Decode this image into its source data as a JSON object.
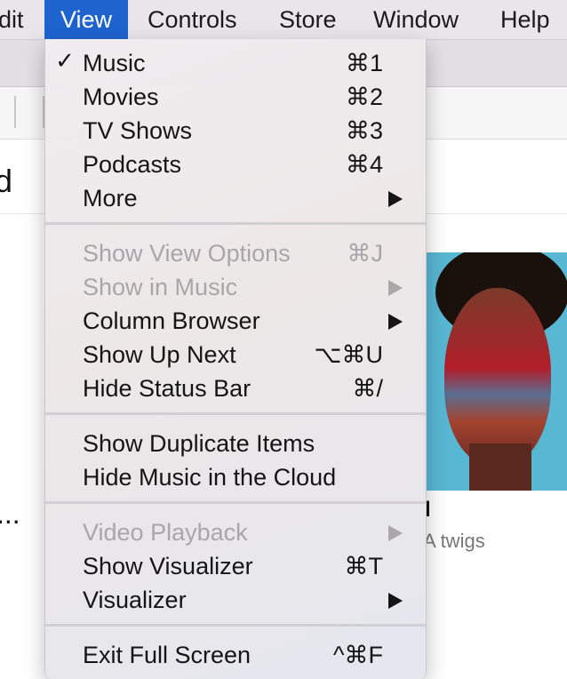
{
  "menubar": {
    "items": [
      "dit",
      "View",
      "Controls",
      "Store",
      "Window",
      "Help"
    ],
    "active_index": 1,
    "accent_color": "#1f63cf"
  },
  "background": {
    "title_fragment": "d",
    "ellipsis": "...",
    "album_caption_1": "l",
    "album_caption_2": "A twigs"
  },
  "view_menu": {
    "sections": [
      [
        {
          "label": "Music",
          "shortcut": "⌘1",
          "checked": true,
          "enabled": true,
          "submenu": false
        },
        {
          "label": "Movies",
          "shortcut": "⌘2",
          "checked": false,
          "enabled": true,
          "submenu": false
        },
        {
          "label": "TV Shows",
          "shortcut": "⌘3",
          "checked": false,
          "enabled": true,
          "submenu": false
        },
        {
          "label": "Podcasts",
          "shortcut": "⌘4",
          "checked": false,
          "enabled": true,
          "submenu": false
        },
        {
          "label": "More",
          "shortcut": "",
          "checked": false,
          "enabled": true,
          "submenu": true
        }
      ],
      [
        {
          "label": "Show View Options",
          "shortcut": "⌘J",
          "checked": false,
          "enabled": false,
          "submenu": false
        },
        {
          "label": "Show in Music",
          "shortcut": "",
          "checked": false,
          "enabled": false,
          "submenu": true
        },
        {
          "label": "Column Browser",
          "shortcut": "",
          "checked": false,
          "enabled": true,
          "submenu": true
        },
        {
          "label": "Show Up Next",
          "shortcut": "⌥⌘U",
          "checked": false,
          "enabled": true,
          "submenu": false
        },
        {
          "label": "Hide Status Bar",
          "shortcut": "⌘/",
          "checked": false,
          "enabled": true,
          "submenu": false
        }
      ],
      [
        {
          "label": "Show Duplicate Items",
          "shortcut": "",
          "checked": false,
          "enabled": true,
          "submenu": false
        },
        {
          "label": "Hide Music in the Cloud",
          "shortcut": "",
          "checked": false,
          "enabled": true,
          "submenu": false
        }
      ],
      [
        {
          "label": "Video Playback",
          "shortcut": "",
          "checked": false,
          "enabled": false,
          "submenu": true
        },
        {
          "label": "Show Visualizer",
          "shortcut": "⌘T",
          "checked": false,
          "enabled": true,
          "submenu": false
        },
        {
          "label": "Visualizer",
          "shortcut": "",
          "checked": false,
          "enabled": true,
          "submenu": true
        }
      ],
      [
        {
          "label": "Exit Full Screen",
          "shortcut": "^⌘F",
          "checked": false,
          "enabled": true,
          "submenu": false
        }
      ]
    ],
    "checkmark": "✓"
  }
}
